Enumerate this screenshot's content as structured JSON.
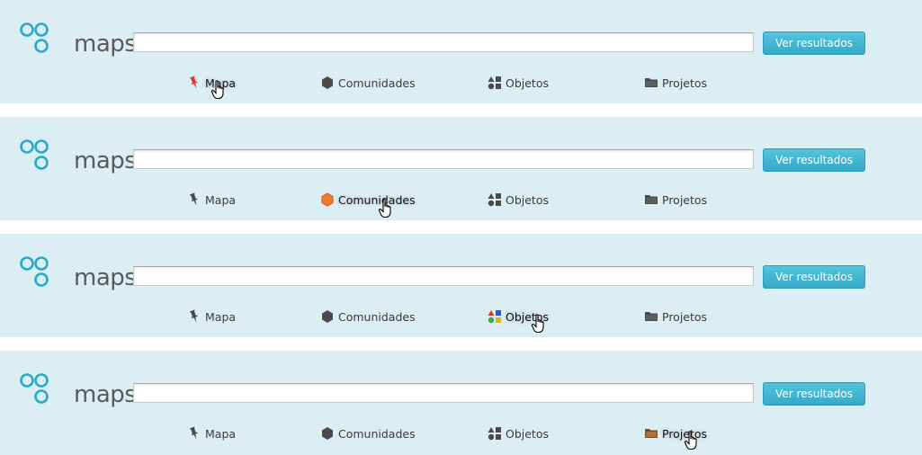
{
  "logo_text": "maps",
  "search": {
    "value": "",
    "placeholder": ""
  },
  "results_button_label": "Ver resultados",
  "nav_labels": {
    "map": "Mapa",
    "communities": "Comunidades",
    "objects": "Objetos",
    "projects": "Projetos"
  },
  "panels": [
    {
      "active_tab": "Mapa"
    },
    {
      "active_tab": "Comunidades"
    },
    {
      "active_tab": "Objetos"
    },
    {
      "active_tab": "Projetos"
    }
  ],
  "colors": {
    "panel_background": "#dbeef4",
    "button": "#3fb2cf",
    "logo_ring": "#2aa9c9",
    "icon_inactive": "#4a4a4a",
    "map_active": "#e53935",
    "community_active": "#f07e26",
    "objects_active": [
      "#d9392b",
      "#2d59c9",
      "#3ea64b",
      "#e2b418"
    ],
    "projects_active": "#8a5a2b"
  },
  "icons": {
    "map": "pushpin-icon",
    "communities": "hexagon-icon",
    "objects": "shapes-icon",
    "projects": "folder-icon",
    "cursor": "hand-pointer-icon"
  }
}
